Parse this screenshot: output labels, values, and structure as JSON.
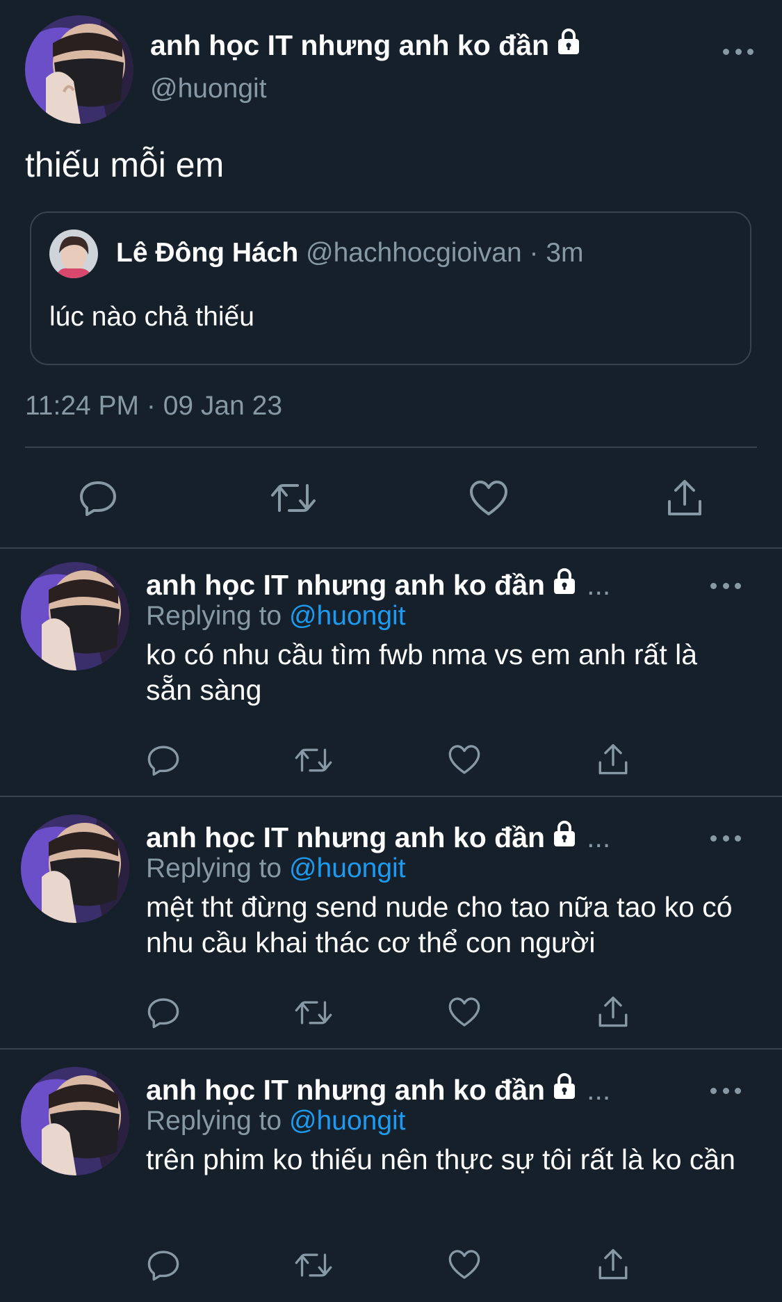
{
  "main_tweet": {
    "author_name": "anh học IT nhưng anh ko đần",
    "author_handle": "@huongit",
    "text": "thiếu mỗi em",
    "timestamp": "11:24 PM · 09 Jan 23",
    "quoted": {
      "author_name": "Lê Đông Hách",
      "meta": "@hachhocgioivan · 3m",
      "text": "lúc nào chả thiếu"
    }
  },
  "icons": {
    "lock": "lock-icon",
    "more": "more-icon",
    "reply": "reply-icon",
    "retweet": "retweet-icon",
    "like": "like-icon",
    "share": "share-icon"
  },
  "replies": [
    {
      "author_name": "anh học IT nhưng anh ko đần",
      "ellipsis": "...",
      "replying_prefix": "Replying to",
      "replying_to": "@huongit",
      "text": "ko có nhu cầu tìm fwb nma vs em anh rất là sẵn sàng"
    },
    {
      "author_name": "anh học IT nhưng anh ko đần",
      "ellipsis": "...",
      "replying_prefix": "Replying to",
      "replying_to": "@huongit",
      "text": "mệt tht đừng send nude cho tao nữa tao ko có nhu cầu khai thác cơ thể con người"
    },
    {
      "author_name": "anh học IT nhưng anh ko đần",
      "ellipsis": "...",
      "replying_prefix": "Replying to",
      "replying_to": "@huongit",
      "text": "trên phim ko thiếu nên thực sự tôi rất là ko cần"
    }
  ],
  "colors": {
    "background": "#15202b",
    "secondary_text": "#8899a6",
    "link": "#1d9bf0",
    "divider": "#38444d"
  }
}
